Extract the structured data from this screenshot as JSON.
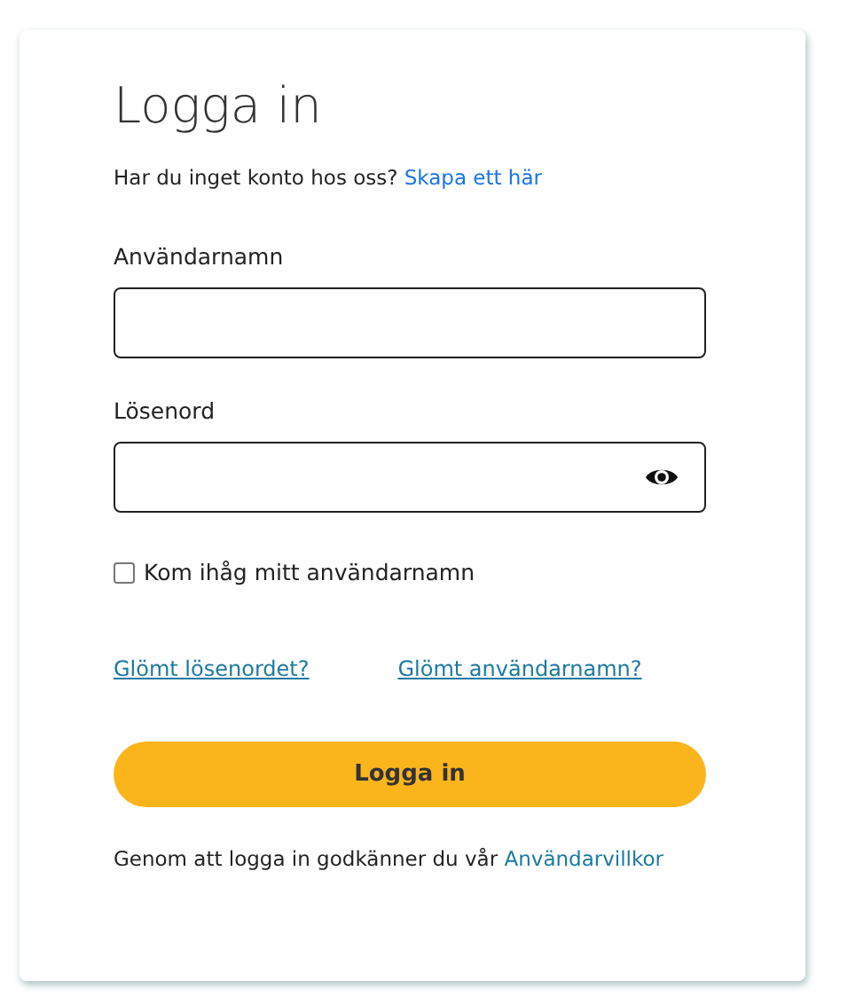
{
  "title": "Logga in",
  "signup": {
    "text": "Har du inget konto hos oss?",
    "link": "Skapa ett här"
  },
  "fields": [
    {
      "label": "Användarnamn",
      "kind": "text"
    },
    {
      "label": "Lösenord",
      "kind": "password"
    }
  ],
  "remember": {
    "label": "Kom ihåg mitt användarnamn",
    "checked": false
  },
  "links": [
    "Glömt lösenordet?",
    "Glömt användarnamn?"
  ],
  "submit": "Logga in",
  "terms": {
    "text": "Genom att logga in godkänner du vår",
    "link": "Användarvillkor"
  }
}
